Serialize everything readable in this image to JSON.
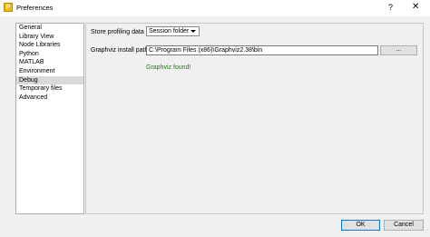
{
  "window": {
    "title": "Preferences",
    "help_label": "?",
    "close_label": "✕"
  },
  "sidebar": {
    "items": [
      {
        "label": "General"
      },
      {
        "label": "Library View"
      },
      {
        "label": "Node Libraries"
      },
      {
        "label": "Python"
      },
      {
        "label": "MATLAB"
      },
      {
        "label": "Environment"
      },
      {
        "label": "Debug"
      },
      {
        "label": "Temporary files"
      },
      {
        "label": "Advanced"
      }
    ],
    "selected_index": 6
  },
  "debug": {
    "profiling_label": "Store profiling data in",
    "profiling_value": "Session folder",
    "graphviz_label": "Graphviz install path",
    "graphviz_path": "C:\\Program Files (x86)\\Graphviz2.38\\bin",
    "browse_label": "...",
    "status_text": "Graphviz found!"
  },
  "footer": {
    "ok_label": "OK",
    "cancel_label": "Cancel"
  },
  "colors": {
    "status_ok": "#128a00",
    "focus_border": "#0078d7",
    "selected_bg": "#d9d9d9"
  }
}
